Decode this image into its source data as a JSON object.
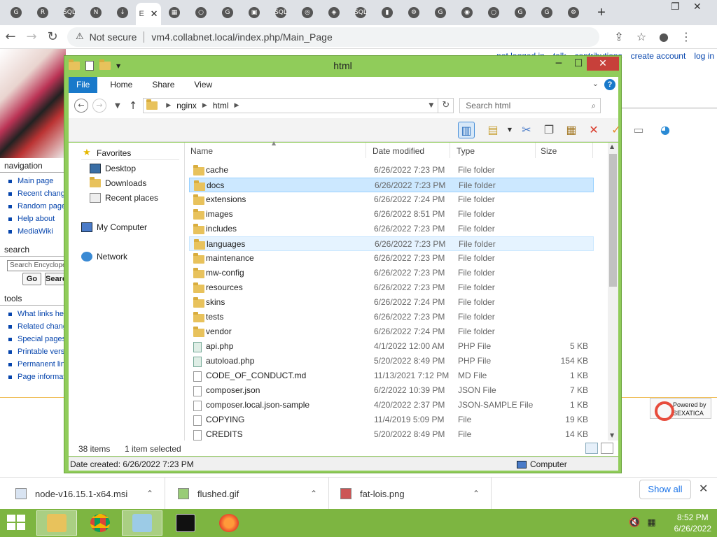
{
  "browser": {
    "address": {
      "warning": "Not secure",
      "url": "vm4.collabnet.local/index.php/Main_Page"
    },
    "tabs": [
      {
        "icon": "G"
      },
      {
        "icon": "R"
      },
      {
        "icon": "SQL"
      },
      {
        "icon": "N"
      },
      {
        "icon": "↓"
      }
    ],
    "active_tab_label": "E",
    "tabs_after": [
      {
        "icon": "▦"
      },
      {
        "icon": "○"
      },
      {
        "icon": "G"
      },
      {
        "icon": "▣"
      },
      {
        "icon": "SQL"
      },
      {
        "icon": "◎"
      },
      {
        "icon": "◈"
      },
      {
        "icon": "SQL"
      },
      {
        "icon": "▮"
      },
      {
        "icon": "⚙"
      },
      {
        "icon": "G"
      },
      {
        "icon": "◉"
      },
      {
        "icon": "○"
      },
      {
        "icon": "G"
      },
      {
        "icon": "G"
      },
      {
        "icon": "⚙"
      }
    ],
    "new_tab": "+"
  },
  "wiki": {
    "personal": [
      "not logged in",
      "talk",
      "contributions",
      "create account",
      "log in"
    ],
    "navigation": {
      "title": "navigation",
      "items": [
        "Main page",
        "Recent changes",
        "Random page",
        "Help about",
        "MediaWiki"
      ]
    },
    "search": {
      "title": "search",
      "placeholder": "Search Encyclopedia",
      "go": "Go",
      "search_btn": "Search"
    },
    "tools": {
      "title": "tools",
      "items": [
        "What links here",
        "Related changes",
        "Special pages",
        "Printable version",
        "Permanent link",
        "Page information"
      ]
    },
    "powered": {
      "line1": "Powered by",
      "line2": "SEXATICA"
    }
  },
  "explorer": {
    "title": "html",
    "ribbon_tabs": [
      "File",
      "Home",
      "Share",
      "View"
    ],
    "breadcrumb": [
      "nginx",
      "html"
    ],
    "search_placeholder": "Search html",
    "nav_pane": {
      "favorites": "Favorites",
      "fav_items": [
        "Desktop",
        "Downloads",
        "Recent places"
      ],
      "computer": "My Computer",
      "network": "Network"
    },
    "columns": {
      "name": "Name",
      "date": "Date modified",
      "type": "Type",
      "size": "Size"
    },
    "rows": [
      {
        "name": "cache",
        "date": "6/26/2022 7:23 PM",
        "type": "File folder",
        "size": "",
        "kind": "folder",
        "state": ""
      },
      {
        "name": "docs",
        "date": "6/26/2022 7:23 PM",
        "type": "File folder",
        "size": "",
        "kind": "folder",
        "state": "selected"
      },
      {
        "name": "extensions",
        "date": "6/26/2022 7:24 PM",
        "type": "File folder",
        "size": "",
        "kind": "folder",
        "state": ""
      },
      {
        "name": "images",
        "date": "6/26/2022 8:51 PM",
        "type": "File folder",
        "size": "",
        "kind": "folder",
        "state": ""
      },
      {
        "name": "includes",
        "date": "6/26/2022 7:23 PM",
        "type": "File folder",
        "size": "",
        "kind": "folder",
        "state": ""
      },
      {
        "name": "languages",
        "date": "6/26/2022 7:23 PM",
        "type": "File folder",
        "size": "",
        "kind": "folder",
        "state": "hover"
      },
      {
        "name": "maintenance",
        "date": "6/26/2022 7:23 PM",
        "type": "File folder",
        "size": "",
        "kind": "folder",
        "state": ""
      },
      {
        "name": "mw-config",
        "date": "6/26/2022 7:23 PM",
        "type": "File folder",
        "size": "",
        "kind": "folder",
        "state": ""
      },
      {
        "name": "resources",
        "date": "6/26/2022 7:23 PM",
        "type": "File folder",
        "size": "",
        "kind": "folder",
        "state": ""
      },
      {
        "name": "skins",
        "date": "6/26/2022 7:24 PM",
        "type": "File folder",
        "size": "",
        "kind": "folder",
        "state": ""
      },
      {
        "name": "tests",
        "date": "6/26/2022 7:23 PM",
        "type": "File folder",
        "size": "",
        "kind": "folder",
        "state": ""
      },
      {
        "name": "vendor",
        "date": "6/26/2022 7:24 PM",
        "type": "File folder",
        "size": "",
        "kind": "folder",
        "state": ""
      },
      {
        "name": "api.php",
        "date": "4/1/2022 12:00 AM",
        "type": "PHP File",
        "size": "5 KB",
        "kind": "php",
        "state": ""
      },
      {
        "name": "autoload.php",
        "date": "5/20/2022 8:49 PM",
        "type": "PHP File",
        "size": "154 KB",
        "kind": "php",
        "state": ""
      },
      {
        "name": "CODE_OF_CONDUCT.md",
        "date": "11/13/2021 7:12 PM",
        "type": "MD File",
        "size": "1 KB",
        "kind": "file",
        "state": ""
      },
      {
        "name": "composer.json",
        "date": "6/2/2022 10:39 PM",
        "type": "JSON File",
        "size": "7 KB",
        "kind": "file",
        "state": ""
      },
      {
        "name": "composer.local.json-sample",
        "date": "4/20/2022 2:37 PM",
        "type": "JSON-SAMPLE File",
        "size": "1 KB",
        "kind": "file",
        "state": ""
      },
      {
        "name": "COPYING",
        "date": "11/4/2019 5:09 PM",
        "type": "File",
        "size": "19 KB",
        "kind": "file",
        "state": ""
      },
      {
        "name": "CREDITS",
        "date": "5/20/2022 8:49 PM",
        "type": "File",
        "size": "14 KB",
        "kind": "file",
        "state": ""
      }
    ],
    "status": {
      "count": "38 items",
      "selected": "1 item selected"
    },
    "details": {
      "created": "Date created: 6/26/2022 7:23 PM",
      "location": "Computer"
    }
  },
  "downloads": {
    "items": [
      "node-v16.15.1-x64.msi",
      "flushed.gif",
      "fat-lois.png"
    ],
    "show_all": "Show all"
  },
  "taskbar": {
    "time": "8:52 PM",
    "date": "6/26/2022"
  },
  "colors": {
    "accent": "#1979ca",
    "window_frame": "#90cc5a",
    "taskbar": "#7db541",
    "close": "#c7403a",
    "selection": "#cce8ff"
  }
}
